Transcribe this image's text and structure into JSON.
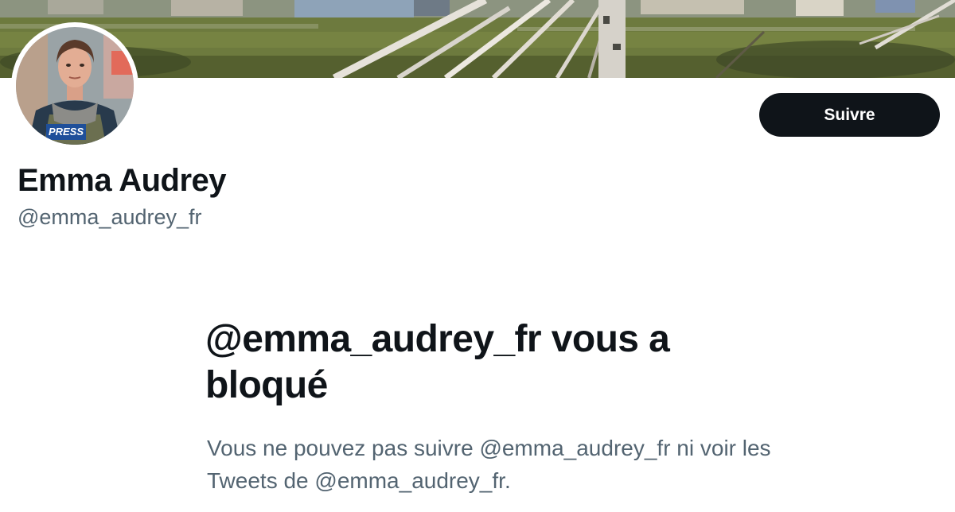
{
  "profile": {
    "display_name": "Emma Audrey",
    "handle": "@emma_audrey_fr",
    "avatar_badge_text": "PRESS"
  },
  "actions": {
    "follow_label": "Suivre"
  },
  "blocked": {
    "title": "@emma_audrey_fr vous a bloqué",
    "message": "Vous ne pouvez pas suivre @emma_audrey_fr ni voir les Tweets de @emma_audrey_fr."
  },
  "colors": {
    "button_bg": "#0f1419",
    "secondary_text": "#536471",
    "primary_text": "#0f1419"
  }
}
